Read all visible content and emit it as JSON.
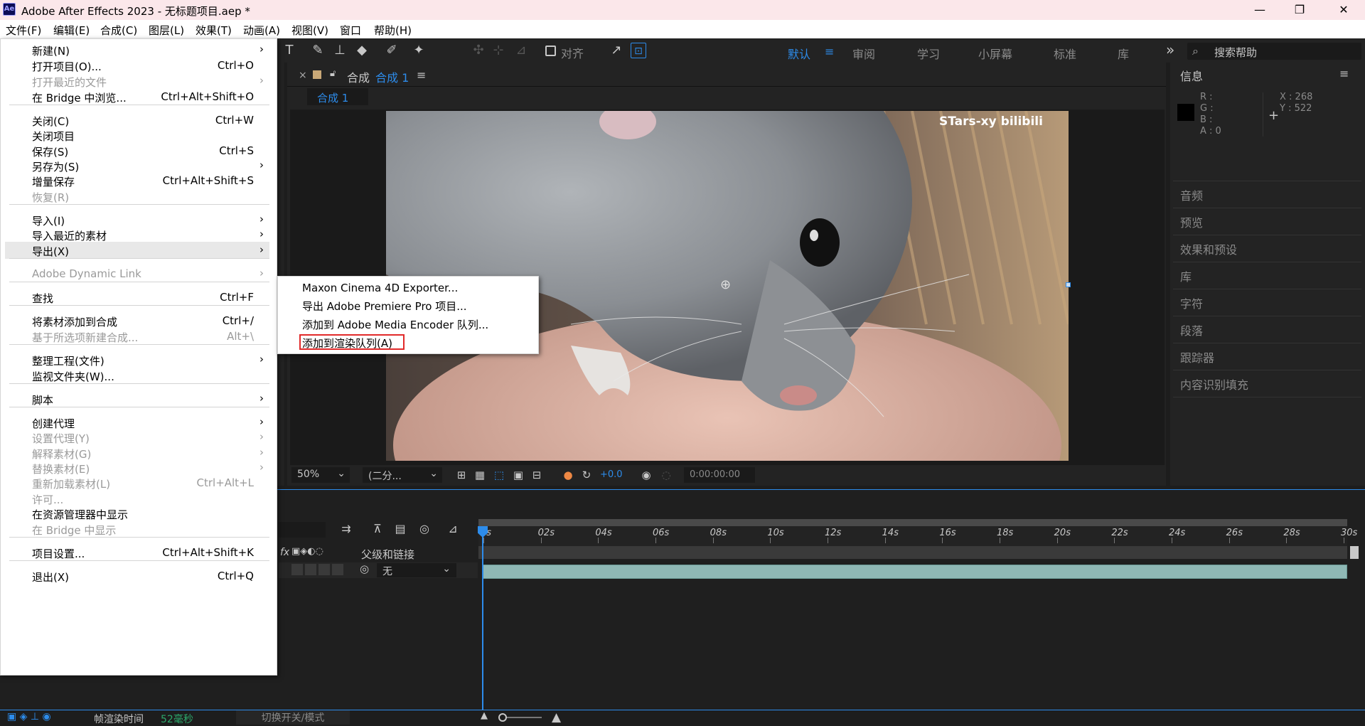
{
  "window": {
    "title": "Adobe After Effects 2023 - 无标题项目.aep *",
    "app_icon_text": "Ae",
    "minimize": "—",
    "maximize": "❐",
    "close": "✕"
  },
  "menubar": [
    "文件(F)",
    "编辑(E)",
    "合成(C)",
    "图层(L)",
    "效果(T)",
    "动画(A)",
    "视图(V)",
    "窗口",
    "帮助(H)"
  ],
  "toolbar": {
    "align_label": "对齐",
    "workspaces": [
      "默认",
      "审阅",
      "学习",
      "小屏幕",
      "标准",
      "库"
    ],
    "workspace_menu": "≡",
    "more": "»",
    "search_placeholder": "搜索帮助"
  },
  "file_menu": [
    {
      "label": "新建(N)",
      "shortcut": "",
      "submenu": true,
      "disabled": false
    },
    {
      "label": "打开项目(O)...",
      "shortcut": "Ctrl+O",
      "submenu": false,
      "disabled": false
    },
    {
      "label": "打开最近的文件",
      "shortcut": "",
      "submenu": true,
      "disabled": true
    },
    {
      "label": "在 Bridge 中浏览...",
      "shortcut": "Ctrl+Alt+Shift+O",
      "submenu": false,
      "disabled": false
    },
    {
      "label": "关闭(C)",
      "shortcut": "Ctrl+W",
      "submenu": false,
      "disabled": false
    },
    {
      "label": "关闭项目",
      "shortcut": "",
      "submenu": false,
      "disabled": false
    },
    {
      "label": "保存(S)",
      "shortcut": "Ctrl+S",
      "submenu": false,
      "disabled": false
    },
    {
      "label": "另存为(S)",
      "shortcut": "",
      "submenu": true,
      "disabled": false
    },
    {
      "label": "增量保存",
      "shortcut": "Ctrl+Alt+Shift+S",
      "submenu": false,
      "disabled": false
    },
    {
      "label": "恢复(R)",
      "shortcut": "",
      "submenu": false,
      "disabled": true
    },
    {
      "label": "导入(I)",
      "shortcut": "",
      "submenu": true,
      "disabled": false
    },
    {
      "label": "导入最近的素材",
      "shortcut": "",
      "submenu": true,
      "disabled": false
    },
    {
      "label": "导出(X)",
      "shortcut": "",
      "submenu": true,
      "disabled": false
    },
    {
      "label": "Adobe Dynamic Link",
      "shortcut": "",
      "submenu": true,
      "disabled": true
    },
    {
      "label": "查找",
      "shortcut": "Ctrl+F",
      "submenu": false,
      "disabled": false
    },
    {
      "label": "将素材添加到合成",
      "shortcut": "Ctrl+/",
      "submenu": false,
      "disabled": false
    },
    {
      "label": "基于所选项新建合成...",
      "shortcut": "Alt+\\",
      "submenu": false,
      "disabled": true
    },
    {
      "label": "整理工程(文件)",
      "shortcut": "",
      "submenu": true,
      "disabled": false
    },
    {
      "label": "监视文件夹(W)...",
      "shortcut": "",
      "submenu": false,
      "disabled": false
    },
    {
      "label": "脚本",
      "shortcut": "",
      "submenu": true,
      "disabled": false
    },
    {
      "label": "创建代理",
      "shortcut": "",
      "submenu": true,
      "disabled": false
    },
    {
      "label": "设置代理(Y)",
      "shortcut": "",
      "submenu": true,
      "disabled": true
    },
    {
      "label": "解释素材(G)",
      "shortcut": "",
      "submenu": true,
      "disabled": true
    },
    {
      "label": "替换素材(E)",
      "shortcut": "",
      "submenu": true,
      "disabled": true
    },
    {
      "label": "重新加载素材(L)",
      "shortcut": "Ctrl+Alt+L",
      "submenu": false,
      "disabled": true
    },
    {
      "label": "许可...",
      "shortcut": "",
      "submenu": false,
      "disabled": true
    },
    {
      "label": "在资源管理器中显示",
      "shortcut": "",
      "submenu": false,
      "disabled": false
    },
    {
      "label": "在 Bridge 中显示",
      "shortcut": "",
      "submenu": false,
      "disabled": true
    },
    {
      "label": "项目设置...",
      "shortcut": "Ctrl+Alt+Shift+K",
      "submenu": false,
      "disabled": false
    },
    {
      "label": "退出(X)",
      "shortcut": "Ctrl+Q",
      "submenu": false,
      "disabled": false
    }
  ],
  "export_submenu": [
    "Maxon Cinema 4D Exporter...",
    "导出 Adobe Premiere Pro 项目...",
    "添加到 Adobe Media Encoder 队列...",
    "添加到渲染队列(A)"
  ],
  "composition": {
    "close": "×",
    "tab_prefix": "合成",
    "tab_name": "合成 1",
    "menu": "≡",
    "breadcrumb": "合成 1",
    "watermark": "STars-xy bilibili"
  },
  "viewer_bar": {
    "zoom": "50%",
    "resolution": "(二分...",
    "exposure": "+0.0",
    "timecode": "0:00:00:00"
  },
  "info_panel": {
    "title": "信息",
    "menu": "≡",
    "r": "R :",
    "g": "G :",
    "b": "B :",
    "a": "A : 0",
    "x": "X : 268",
    "y": "Y : 522",
    "crosshair": "+"
  },
  "side_panels": [
    "音频",
    "预览",
    "效果和预设",
    "库",
    "字符",
    "段落",
    "跟踪器",
    "内容识别填充"
  ],
  "timeline": {
    "ticks": [
      "0s",
      "02s",
      "04s",
      "06s",
      "08s",
      "10s",
      "12s",
      "14s",
      "16s",
      "18s",
      "20s",
      "22s",
      "24s",
      "26s",
      "28s",
      "30s"
    ],
    "parent_header": "父级和链接",
    "parent_value": "无",
    "fx_label": "fx"
  },
  "statusbar": {
    "render_time_label": "帧渲染时间",
    "render_time_value": "52毫秒",
    "toggle_label": "切换开关/模式"
  },
  "colors": {
    "accent": "#2d8ceb",
    "menu_bg": "#ffffff",
    "highlight_border": "#e12a2a",
    "panel_bg": "#232323"
  }
}
